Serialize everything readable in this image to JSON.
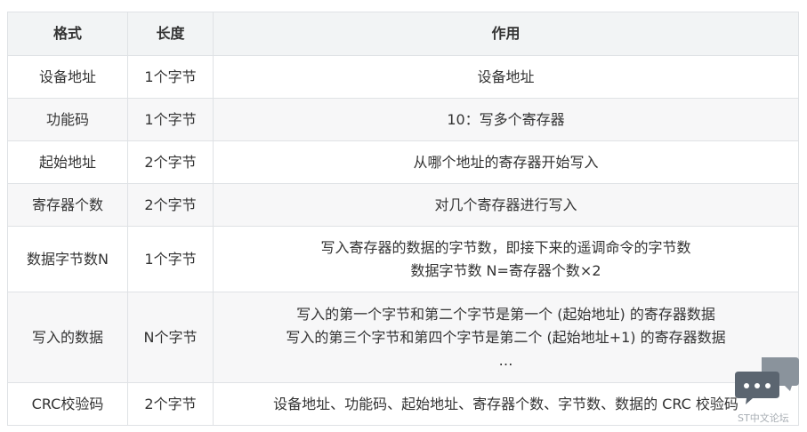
{
  "table": {
    "headers": [
      "格式",
      "长度",
      "作用"
    ],
    "rows": [
      {
        "format": "设备地址",
        "length": "1个字节",
        "purpose": [
          "设备地址"
        ]
      },
      {
        "format": "功能码",
        "length": "1个字节",
        "purpose": [
          "10：写多个寄存器"
        ]
      },
      {
        "format": "起始地址",
        "length": "2个字节",
        "purpose": [
          "从哪个地址的寄存器开始写入"
        ]
      },
      {
        "format": "寄存器个数",
        "length": "2个字节",
        "purpose": [
          "对几个寄存器进行写入"
        ]
      },
      {
        "format": "数据字节数N",
        "length": "1个字节",
        "purpose": [
          "写入寄存器的数据的字节数，即接下来的遥调命令的字节数",
          "数据字节数 N=寄存器个数×2"
        ]
      },
      {
        "format": "写入的数据",
        "length": "N个字节",
        "purpose": [
          "写入的第一个字节和第二个字节是第一个 (起始地址) 的寄存器数据",
          "写入的第三个字节和第四个字节是第二个 (起始地址+1) 的寄存器数据",
          "…"
        ]
      },
      {
        "format": "CRC校验码",
        "length": "2个字节",
        "purpose": [
          "设备地址、功能码、起始地址、寄存器个数、字节数、数据的 CRC 校验码"
        ]
      }
    ]
  },
  "widget": {
    "icon": "chat-bubble-icon",
    "watermark": "ST中文论坛"
  },
  "colors": {
    "header_bg": "#f2f4f5",
    "alt_row_bg": "#f7f7f8",
    "border": "#dfe2e5",
    "widget_dark": "#5b6570",
    "widget_light": "#8a939c"
  }
}
